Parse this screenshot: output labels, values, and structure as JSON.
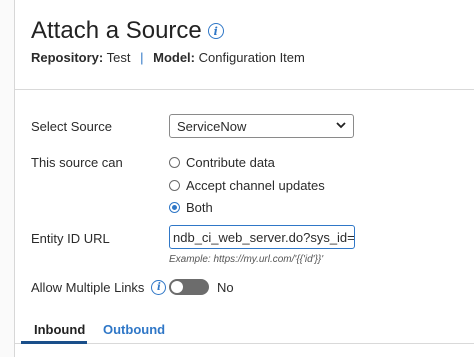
{
  "header": {
    "title": "Attach a Source",
    "repository_label": "Repository:",
    "repository_value": "Test",
    "separator": "|",
    "model_label": "Model:",
    "model_value": "Configuration Item"
  },
  "form": {
    "select_source_label": "Select Source",
    "select_source_value": "ServiceNow",
    "source_can_label": "This source can",
    "options": [
      {
        "label": "Contribute data",
        "checked": false
      },
      {
        "label": "Accept channel updates",
        "checked": false
      },
      {
        "label": "Both",
        "checked": true
      }
    ],
    "entity_url_label": "Entity ID URL",
    "entity_url_value": "ndb_ci_web_server.do?sys_id={id}",
    "entity_url_example": "Example: https://my.url.com/'{{'id'}}'",
    "allow_multiple_label": "Allow Multiple Links",
    "allow_multiple_value": "No",
    "allow_multiple_on": false
  },
  "tabs": [
    {
      "label": "Inbound",
      "active": true
    },
    {
      "label": "Outbound",
      "active": false
    }
  ],
  "colors": {
    "accent": "#2f77c7",
    "toggle_off": "#6c6c6c"
  }
}
